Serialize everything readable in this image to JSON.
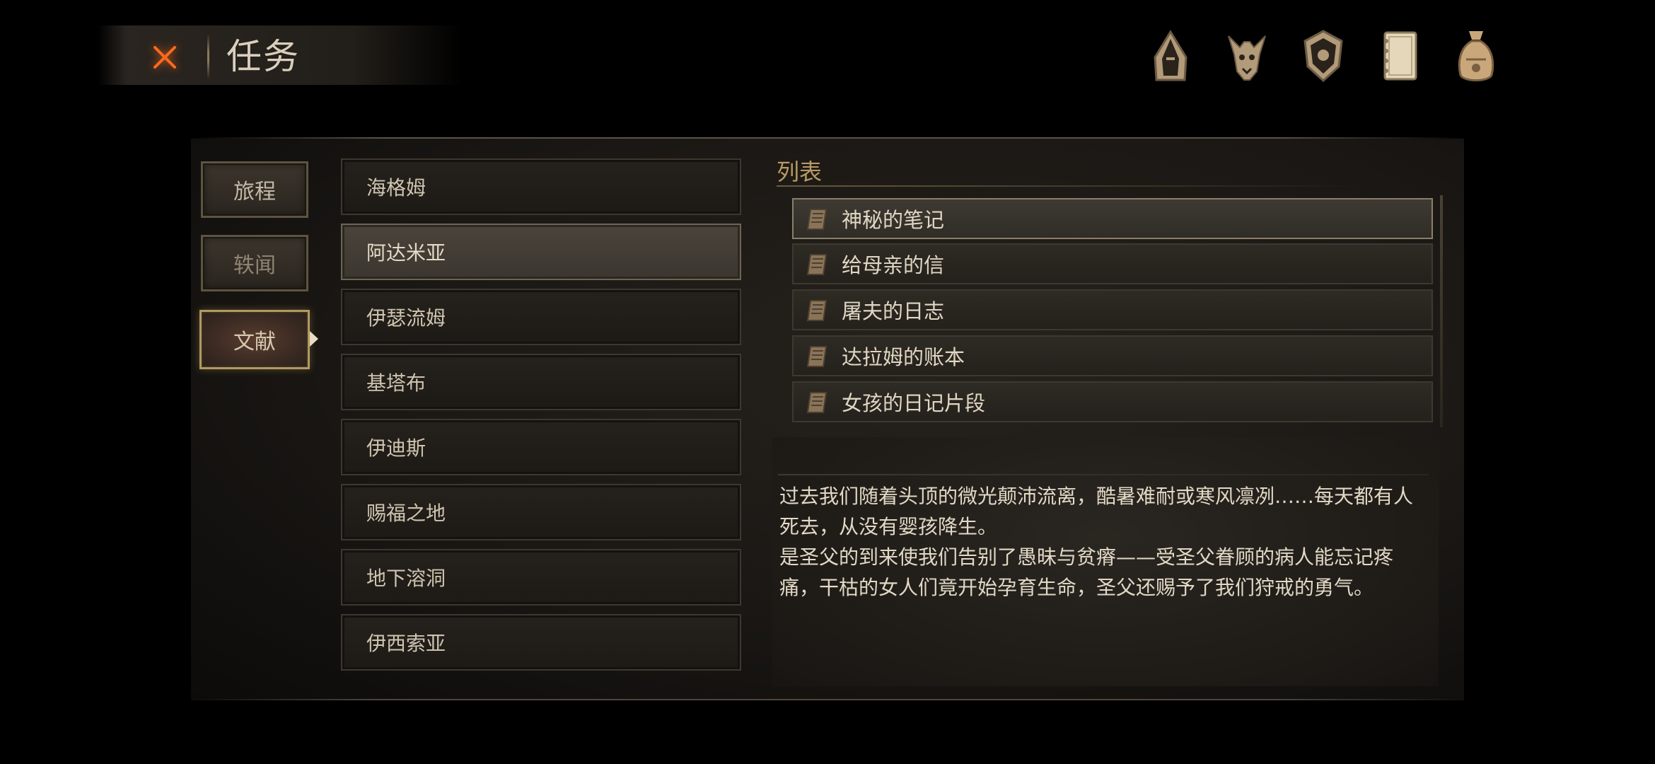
{
  "header": {
    "title": "任务",
    "close_icon": "close-x-icon"
  },
  "top_icons": [
    "hooded-helmet-icon",
    "horned-beast-icon",
    "shield-sun-emblem-icon",
    "journal-book-icon",
    "coin-pouch-icon"
  ],
  "side_tabs": [
    {
      "label": "旅程"
    },
    {
      "label": "轶闻"
    },
    {
      "label": "文献"
    }
  ],
  "side_tab_selected": "文献",
  "regions": [
    {
      "label": "海格姆"
    },
    {
      "label": "阿达米亚"
    },
    {
      "label": "伊瑟流姆"
    },
    {
      "label": "基塔布"
    },
    {
      "label": "伊迪斯"
    },
    {
      "label": "赐福之地"
    },
    {
      "label": "地下溶洞"
    },
    {
      "label": "伊西索亚"
    }
  ],
  "region_selected": "阿达米亚",
  "list": {
    "heading": "列表",
    "items": [
      {
        "label": "神秘的笔记"
      },
      {
        "label": "给母亲的信"
      },
      {
        "label": "屠夫的日志"
      },
      {
        "label": "达拉姆的账本"
      },
      {
        "label": "女孩的日记片段"
      }
    ],
    "selected": "神秘的笔记",
    "item_icon": "scroll-icon"
  },
  "document_text": "过去我们随着头顶的微光颠沛流离，酷暑难耐或寒风凛冽……每天都有人死去，从没有婴孩降生。\n是圣父的到来使我们告别了愚昧与贫瘠——受圣父眷顾的病人能忘记疼痛，干枯的女人们竟开始孕育生命，圣父还赐予了我们狩戒的勇气。",
  "colors": {
    "accent_gold": "#b89a62",
    "close_orange": "#ff6a1a",
    "selected_tab_border": "#b09a63"
  }
}
